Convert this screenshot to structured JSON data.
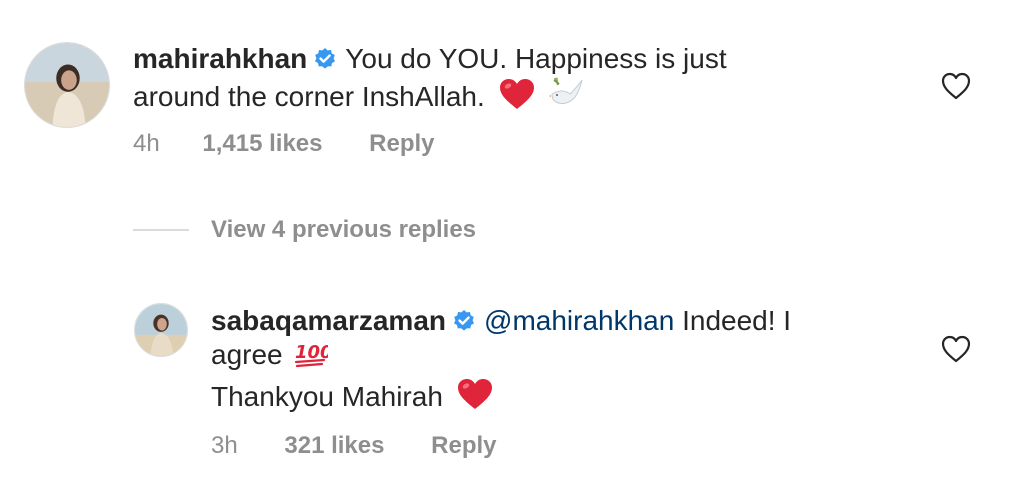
{
  "comments": [
    {
      "username": "mahirahkhan",
      "text_line1": "You do YOU. Happiness is just",
      "text_line2": "around the corner InshAllah.",
      "emojis": [
        "red-heart",
        "dove"
      ],
      "time": "4h",
      "likes": "1,415 likes",
      "reply": "Reply"
    },
    {
      "username": "sabaqamarzaman",
      "mention": "@mahirahkhan",
      "text_line1_rest": "Indeed! I",
      "text_line2": "agree",
      "text_line3": "Thankyou Mahirah",
      "emojis": [
        "hundred-points",
        "red-heart"
      ],
      "time": "3h",
      "likes": "321 likes",
      "reply": "Reply"
    }
  ],
  "view_replies": {
    "label": "View 4 previous replies"
  },
  "colors": {
    "text": "#262626",
    "muted": "#8e8e8e",
    "mention": "#00376b",
    "verified": "#3897f0",
    "heart": "#e0243a"
  }
}
